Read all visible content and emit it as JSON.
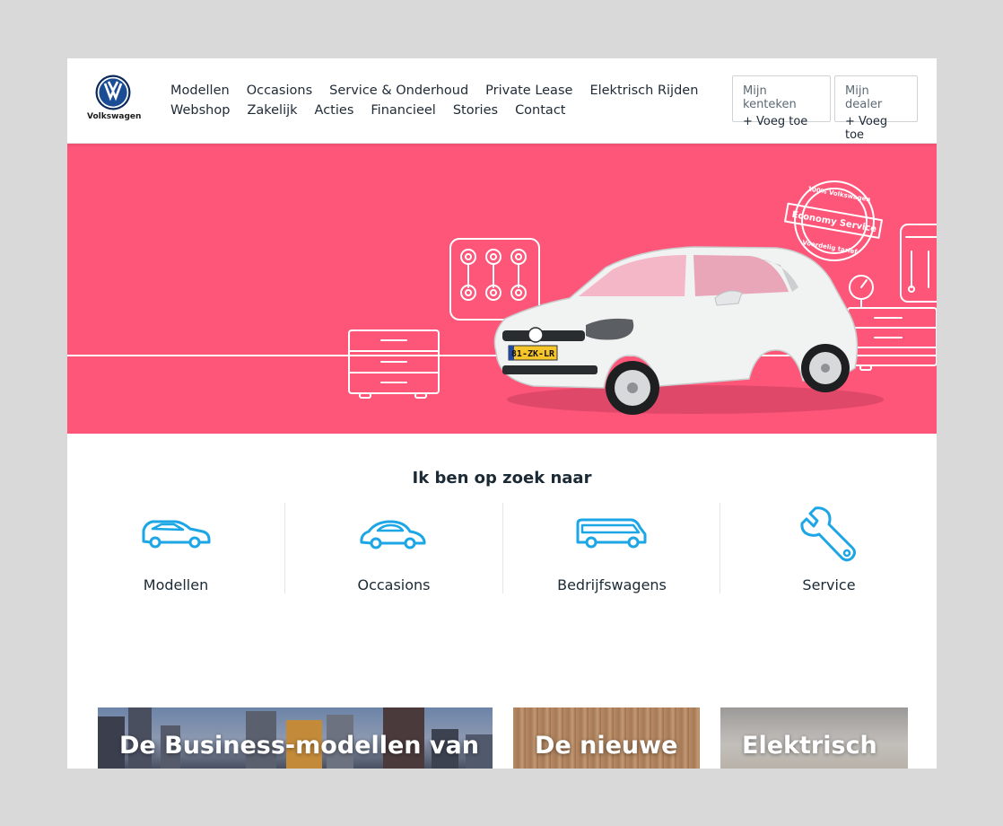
{
  "brand": {
    "name": "Volkswagen"
  },
  "nav": {
    "row1": [
      "Modellen",
      "Occasions",
      "Service & Onderhoud",
      "Private Lease",
      "Elektrisch Rijden"
    ],
    "row2": [
      "Webshop",
      "Zakelijk",
      "Acties",
      "Financieel",
      "Stories",
      "Contact"
    ]
  },
  "header_boxes": [
    {
      "label": "Mijn kenteken",
      "action": "+ Voeg toe"
    },
    {
      "label": "Mijn dealer",
      "action": "+ Voeg toe"
    }
  ],
  "hero": {
    "badge_top": "100% Volkswagen",
    "badge_main": "Economy Service",
    "badge_bottom": "Voordelig tarief",
    "plate": "81-ZK-LR"
  },
  "search_section": {
    "title": "Ik ben op zoek naar",
    "categories": [
      {
        "label": "Modellen",
        "icon": "car-icon"
      },
      {
        "label": "Occasions",
        "icon": "beetle-car-icon"
      },
      {
        "label": "Bedrijfswagens",
        "icon": "van-icon"
      },
      {
        "label": "Service",
        "icon": "wrench-icon"
      }
    ]
  },
  "cards": [
    {
      "title": "De Business-modellen van"
    },
    {
      "title": "De nieuwe"
    },
    {
      "title": "Elektrisch"
    }
  ],
  "colors": {
    "hero_bg": "#fd5679",
    "icon_blue": "#1ca6e6",
    "text_dark": "#1b2a35"
  }
}
